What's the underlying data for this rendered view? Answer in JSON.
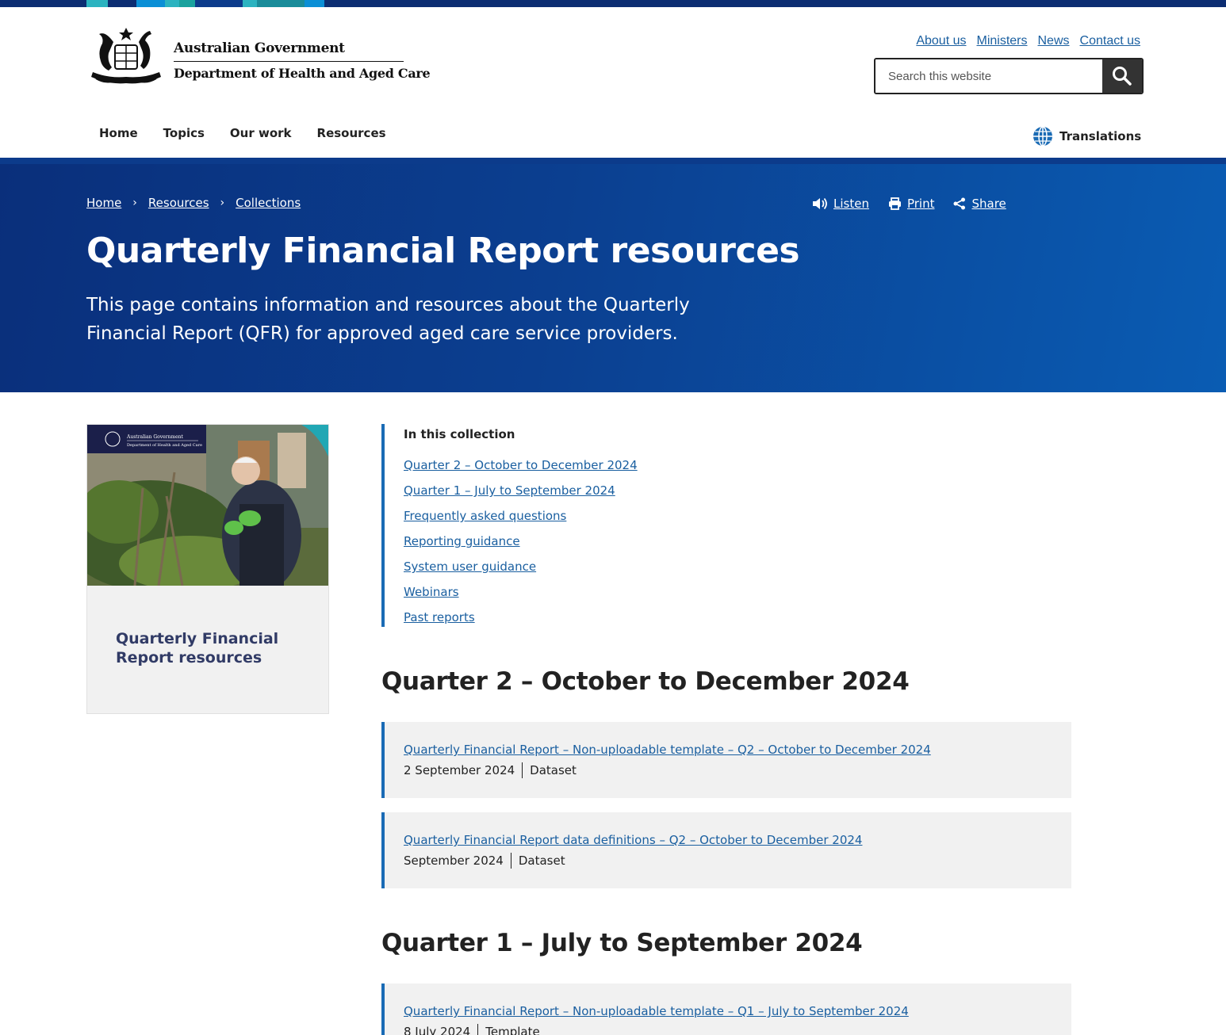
{
  "colors": {
    "brand_dark": "#0c2d72",
    "hero_blue": "#0a3f8f",
    "link": "#1a5fa0",
    "accent_bar": "#1a6bb5",
    "card_title": "#313b66"
  },
  "header": {
    "logo": {
      "line1": "Australian Government",
      "line2": "Department of Health and Aged Care"
    },
    "util_links": [
      "About us",
      "Ministers",
      "News",
      "Contact us"
    ],
    "search": {
      "placeholder": "Search this website",
      "icon": "search-icon"
    },
    "nav": [
      "Home",
      "Topics",
      "Our work",
      "Resources"
    ],
    "translations": {
      "label": "Translations",
      "icon": "globe-icon"
    }
  },
  "hero": {
    "breadcrumb": [
      "Home",
      "Resources",
      "Collections"
    ],
    "actions": [
      {
        "label": "Listen",
        "icon": "speaker-icon"
      },
      {
        "label": "Print",
        "icon": "printer-icon"
      },
      {
        "label": "Share",
        "icon": "share-icon"
      }
    ],
    "title": "Quarterly Financial Report resources",
    "intro": "This page contains information and resources about the Quarterly Financial Report (QFR) for approved aged care service providers."
  },
  "sidebar_card": {
    "image_logo_line1": "Australian Government",
    "image_logo_line2": "Department of Health and Aged Care",
    "title": "Quarterly Financial Report resources"
  },
  "collection": {
    "title": "In this collection",
    "items": [
      "Quarter 2 – October to December 2024",
      "Quarter 1 – July to September 2024",
      "Frequently asked questions",
      "Reporting guidance",
      "System user guidance",
      "Webinars",
      "Past reports"
    ]
  },
  "sections": [
    {
      "heading": "Quarter 2 – October to December 2024",
      "resources": [
        {
          "title": "Quarterly Financial Report – Non-uploadable template – Q2 – October to December 2024",
          "date": "2 September 2024",
          "type": "Dataset"
        },
        {
          "title": "Quarterly Financial Report data definitions – Q2 – October to December 2024",
          "date": "September 2024",
          "type": "Dataset"
        }
      ]
    },
    {
      "heading": "Quarter 1 – July to September 2024",
      "resources": [
        {
          "title": "Quarterly Financial Report – Non-uploadable template – Q1 – July to September 2024",
          "date": "8 July 2024",
          "type": "Template"
        }
      ]
    }
  ]
}
